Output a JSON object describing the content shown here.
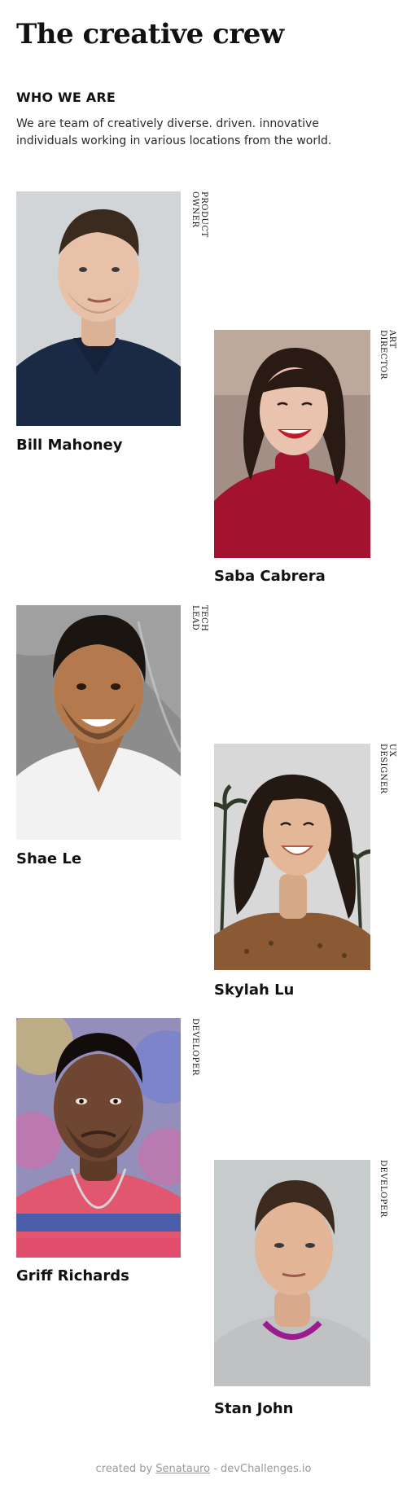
{
  "header": {
    "title": "The creative crew",
    "section_title": "WHO WE ARE",
    "intro": "We are team of creatively diverse. driven. innovative individuals working in various locations from the world."
  },
  "members": [
    {
      "name": "Bill Mahoney",
      "role": "PRODUCT OWNER",
      "photo_bg": "#c9cdd0",
      "shirt": "#1a2a44",
      "skin": "#e8c2a8",
      "hair": "#3b2a1e"
    },
    {
      "name": "Saba Cabrera",
      "role": "ART DIRECTOR",
      "photo_bg": "#a38f85",
      "shirt": "#a3122f",
      "skin": "#e9c3ad",
      "hair": "#2a1a14"
    },
    {
      "name": "Shae Le",
      "role": "TECH LEAD",
      "photo_bg": "#8c8c8c",
      "shirt": "#f2f2f2",
      "skin": "#b47a4e",
      "hair": "#1b1512"
    },
    {
      "name": "Skylah Lu",
      "role": "UX DESIGNER",
      "photo_bg": "#d8d8d8",
      "shirt": "#8b5a34",
      "skin": "#e2b898",
      "hair": "#231912"
    },
    {
      "name": "Griff Richards",
      "role": "DEVELOPER",
      "photo_bg": "#b77ac6",
      "shirt": "#e0576f",
      "skin": "#6e4632",
      "hair": "#120d0b"
    },
    {
      "name": "Stan John",
      "role": "DEVELOPER",
      "photo_bg": "#bfc3c5",
      "shirt": "#bfc1c3",
      "skin": "#e2b596",
      "hair": "#3c2a1e"
    }
  ],
  "footer": {
    "prefix": "created by",
    "author": "Senatauro",
    "suffix": "- devChallenges.io"
  }
}
